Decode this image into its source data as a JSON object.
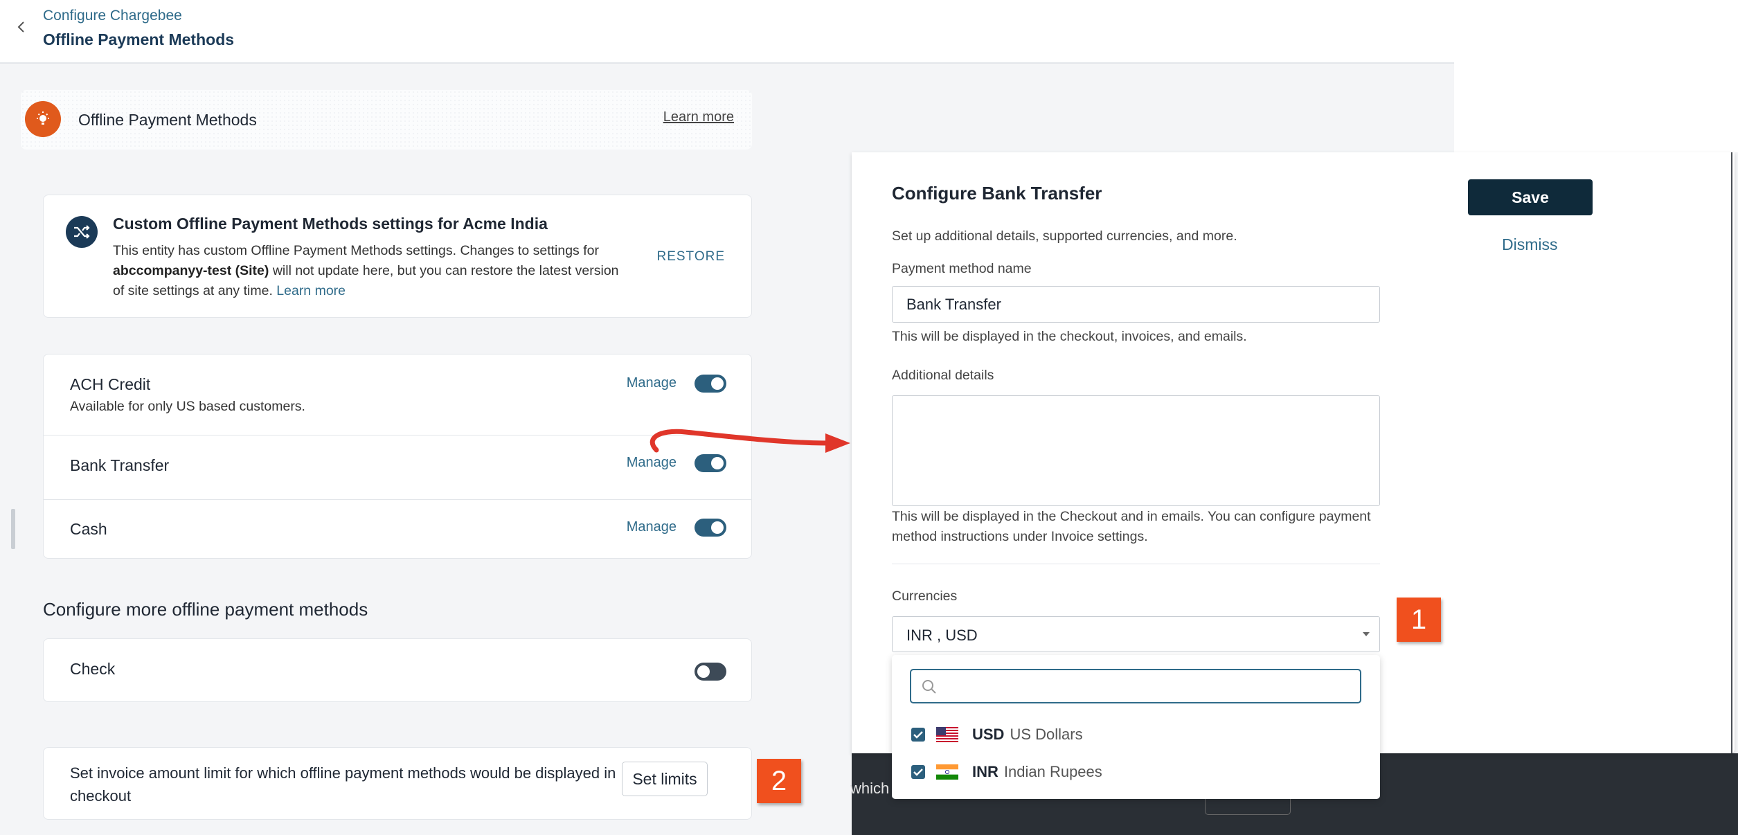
{
  "header": {
    "breadcrumb": "Configure Chargebee",
    "title": "Offline Payment Methods"
  },
  "banner": {
    "title": "Offline Payment Methods",
    "learn_more": "Learn more"
  },
  "custom_settings": {
    "title": "Custom Offline Payment Methods settings for Acme India",
    "desc_part1": "This entity has custom Offline Payment Methods settings. Changes to settings for ",
    "desc_bold": "abccompanyy-test (Site)",
    "desc_part2": " will not update here, but you can restore the latest version of site settings at any time. ",
    "learn_more": "Learn more",
    "restore": "RESTORE"
  },
  "methods": [
    {
      "name": "ACH Credit",
      "subtitle": "Available for only US based customers.",
      "manage": "Manage",
      "enabled": true
    },
    {
      "name": "Bank Transfer",
      "manage": "Manage",
      "enabled": true
    },
    {
      "name": "Cash",
      "manage": "Manage",
      "enabled": true
    }
  ],
  "more_methods": {
    "title": "Configure more offline payment methods",
    "check": {
      "name": "Check",
      "enabled": false
    }
  },
  "limits": {
    "text": "Set invoice amount limit for which offline payment methods would be displayed in checkout",
    "button": "Set limits"
  },
  "overlay": {
    "text": "which"
  },
  "drawer": {
    "title": "Configure Bank Transfer",
    "subtitle": "Set up additional details, supported currencies, and more.",
    "name_label": "Payment method name",
    "name_value": "Bank Transfer",
    "name_help": "This will be displayed in the checkout, invoices, and emails.",
    "details_label": "Additional details",
    "details_value": "",
    "details_help": "This will be displayed in the Checkout and in emails. You can configure payment method instructions under Invoice settings.",
    "currencies_label": "Currencies",
    "currencies_value": "INR ,   USD",
    "save": "Save",
    "dismiss": "Dismiss"
  },
  "currency_dropdown": {
    "search_placeholder": "",
    "options": [
      {
        "code": "USD",
        "name": "US Dollars",
        "checked": true,
        "flag": "us-flag-icon"
      },
      {
        "code": "INR",
        "name": "Indian Rupees",
        "checked": true,
        "flag": "india-flag-icon"
      }
    ]
  },
  "callouts": {
    "one": "1",
    "two": "2"
  },
  "colors": {
    "accent": "#2f6b8a",
    "primary_dark": "#0f2a3a",
    "toggle_on": "#2c5f7d",
    "badge": "#f0501e",
    "banner_icon": "#e05a1c"
  }
}
